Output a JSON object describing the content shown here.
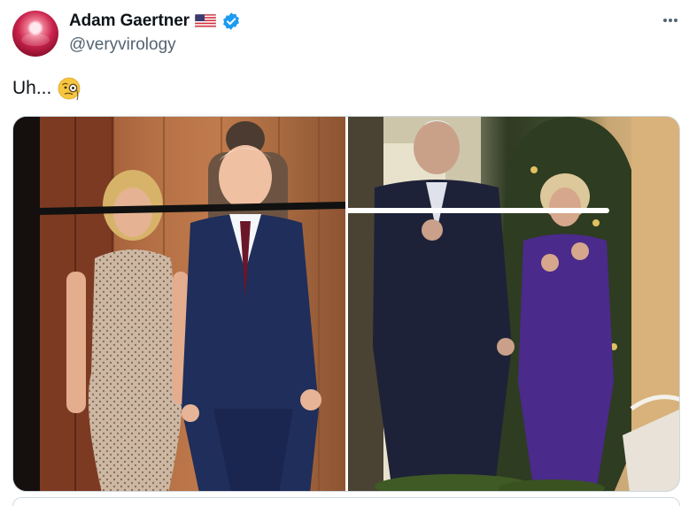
{
  "author": {
    "display_name": "Adam Gaertner",
    "handle": "@veryvirology",
    "flag_icon": "us-flag-icon",
    "verified_icon": "verified-badge-icon",
    "verified_color": "#1d9bf0"
  },
  "tweet": {
    "text": "Uh...",
    "emoji": "monocle-face-icon"
  },
  "media": {
    "images": [
      {
        "name": "left-photo"
      },
      {
        "name": "right-photo"
      }
    ],
    "annotation_colors": {
      "left_line": "#111111",
      "right_line": "#ffffff"
    }
  },
  "menu": {
    "more_icon": "more-options-icon"
  },
  "colors": {
    "text": "#0f1419",
    "secondary": "#536471",
    "border": "#cfd9de"
  }
}
